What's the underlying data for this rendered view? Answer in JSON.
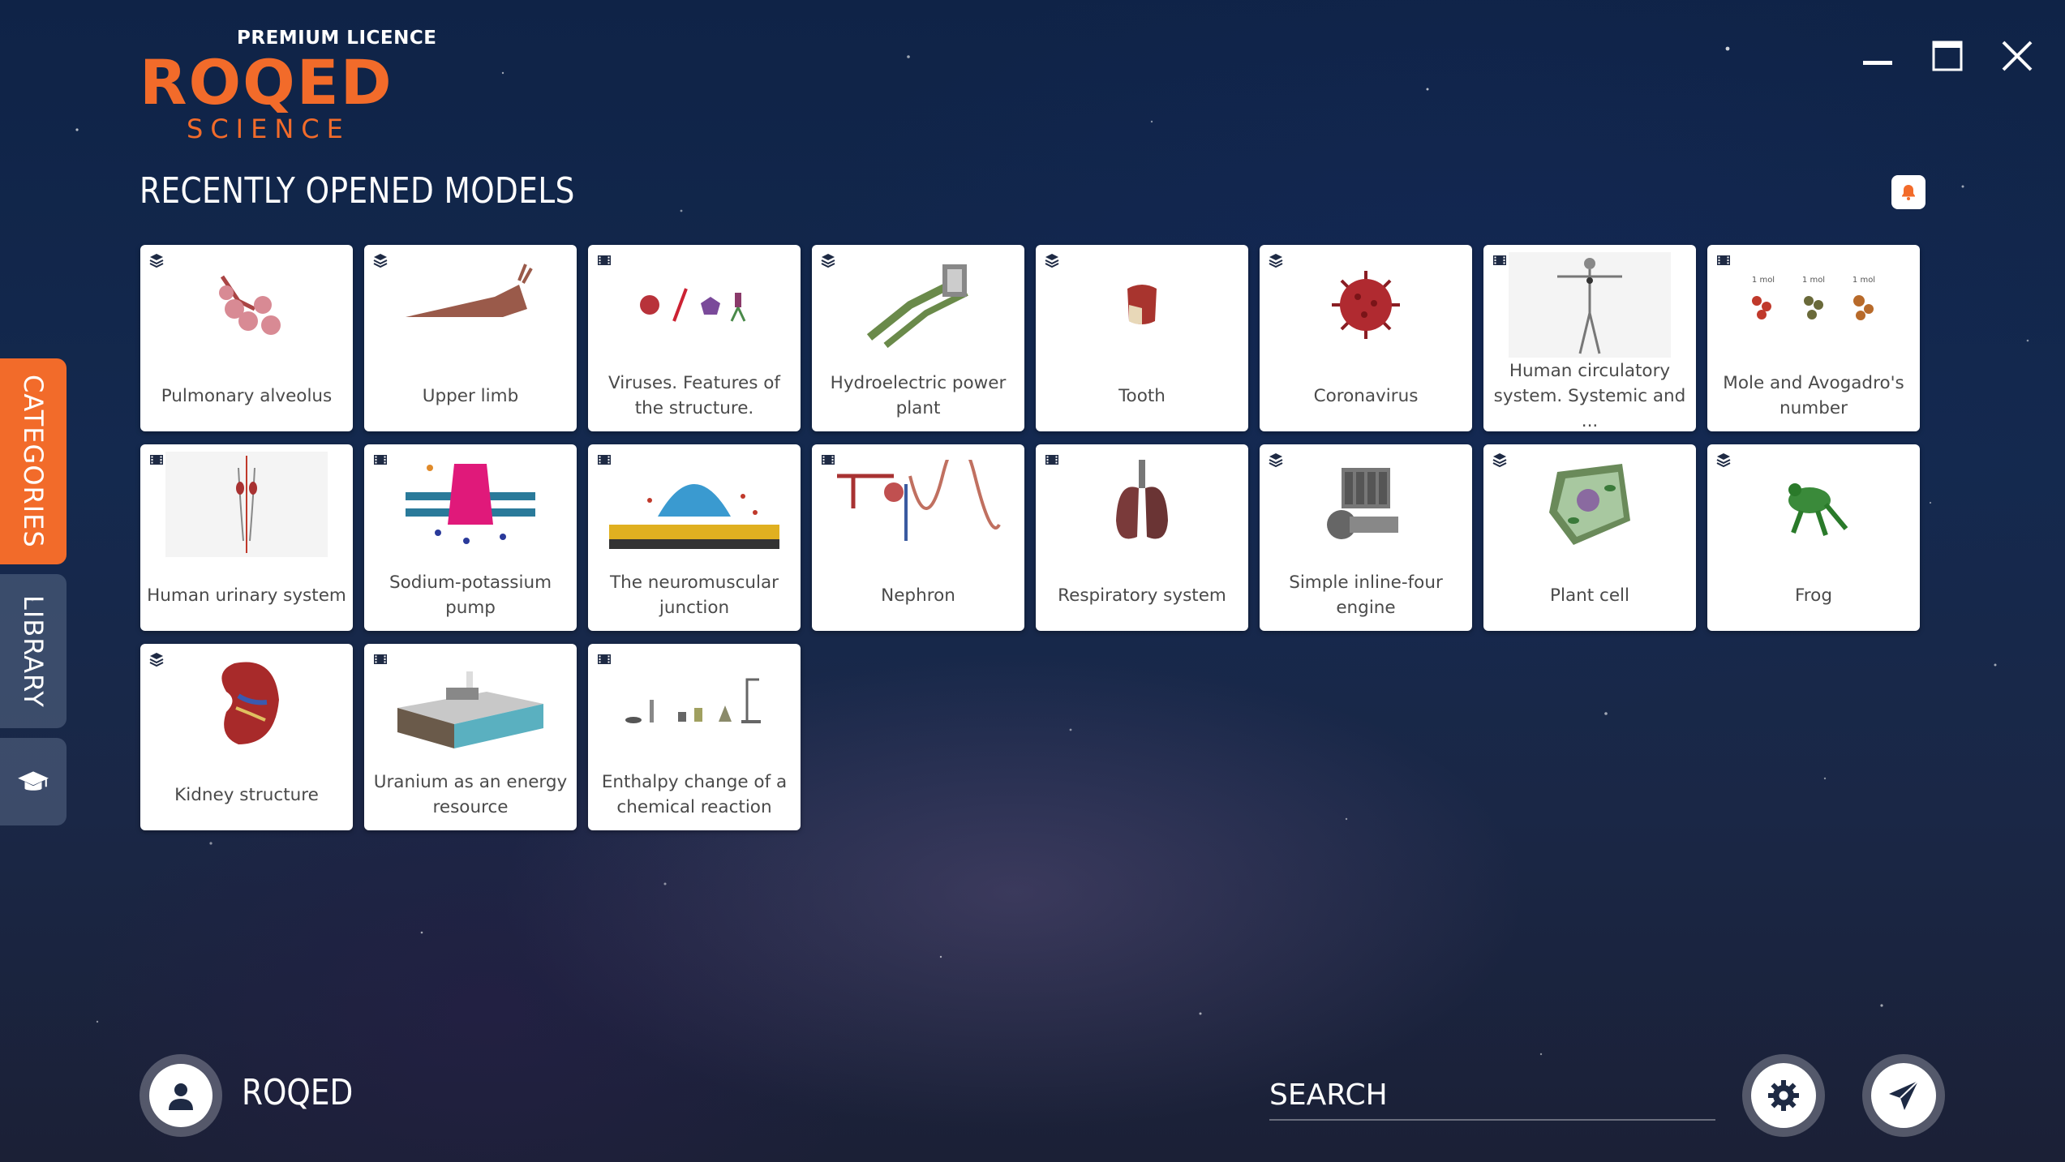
{
  "app": {
    "licence": "PREMIUM LICENCE",
    "brand": "ROQED",
    "brand_sub": "SCIENCE"
  },
  "colors": {
    "accent": "#f26b2a",
    "card_text": "#4a4a4a",
    "background": "#14294e"
  },
  "window_controls": [
    "minimize-icon",
    "maximize-icon",
    "close-icon"
  ],
  "section": {
    "title": "RECENTLY OPENED MODELS"
  },
  "side_tabs": [
    {
      "label": "CATEGORIES",
      "active": true
    },
    {
      "label": "LIBRARY",
      "active": false
    },
    {
      "icon": "graduation-cap-icon",
      "active": false
    }
  ],
  "models": [
    {
      "label": "Pulmonary alveolus",
      "type": "layers-icon"
    },
    {
      "label": "Upper limb",
      "type": "layers-icon"
    },
    {
      "label": "Viruses. Features of the structure.",
      "type": "film-icon"
    },
    {
      "label": "Hydroelectric power plant",
      "type": "layers-icon"
    },
    {
      "label": "Tooth",
      "type": "layers-icon"
    },
    {
      "label": "Coronavirus",
      "type": "layers-icon"
    },
    {
      "label": "Human circulatory system. Systemic and ...",
      "type": "film-icon"
    },
    {
      "label": "Mole and Avogadro's number",
      "type": "film-icon",
      "thumb_text": [
        "1 mol",
        "1 mol",
        "1 mol"
      ]
    },
    {
      "label": "Human urinary system",
      "type": "film-icon"
    },
    {
      "label": "Sodium-potassium pump",
      "type": "film-icon"
    },
    {
      "label": "The neuromuscular junction",
      "type": "film-icon"
    },
    {
      "label": "Nephron",
      "type": "film-icon"
    },
    {
      "label": "Respiratory system",
      "type": "film-icon"
    },
    {
      "label": "Simple inline-four engine",
      "type": "layers-icon"
    },
    {
      "label": "Plant cell",
      "type": "layers-icon"
    },
    {
      "label": "Frog",
      "type": "layers-icon"
    },
    {
      "label": "Kidney structure",
      "type": "layers-icon"
    },
    {
      "label": "Uranium as an energy resource",
      "type": "film-icon"
    },
    {
      "label": "Enthalpy change of a chemical reaction",
      "type": "film-icon"
    }
  ],
  "footer": {
    "user_name": "ROQED",
    "search_placeholder": "SEARCH",
    "buttons": [
      "settings-icon",
      "send-icon"
    ]
  }
}
